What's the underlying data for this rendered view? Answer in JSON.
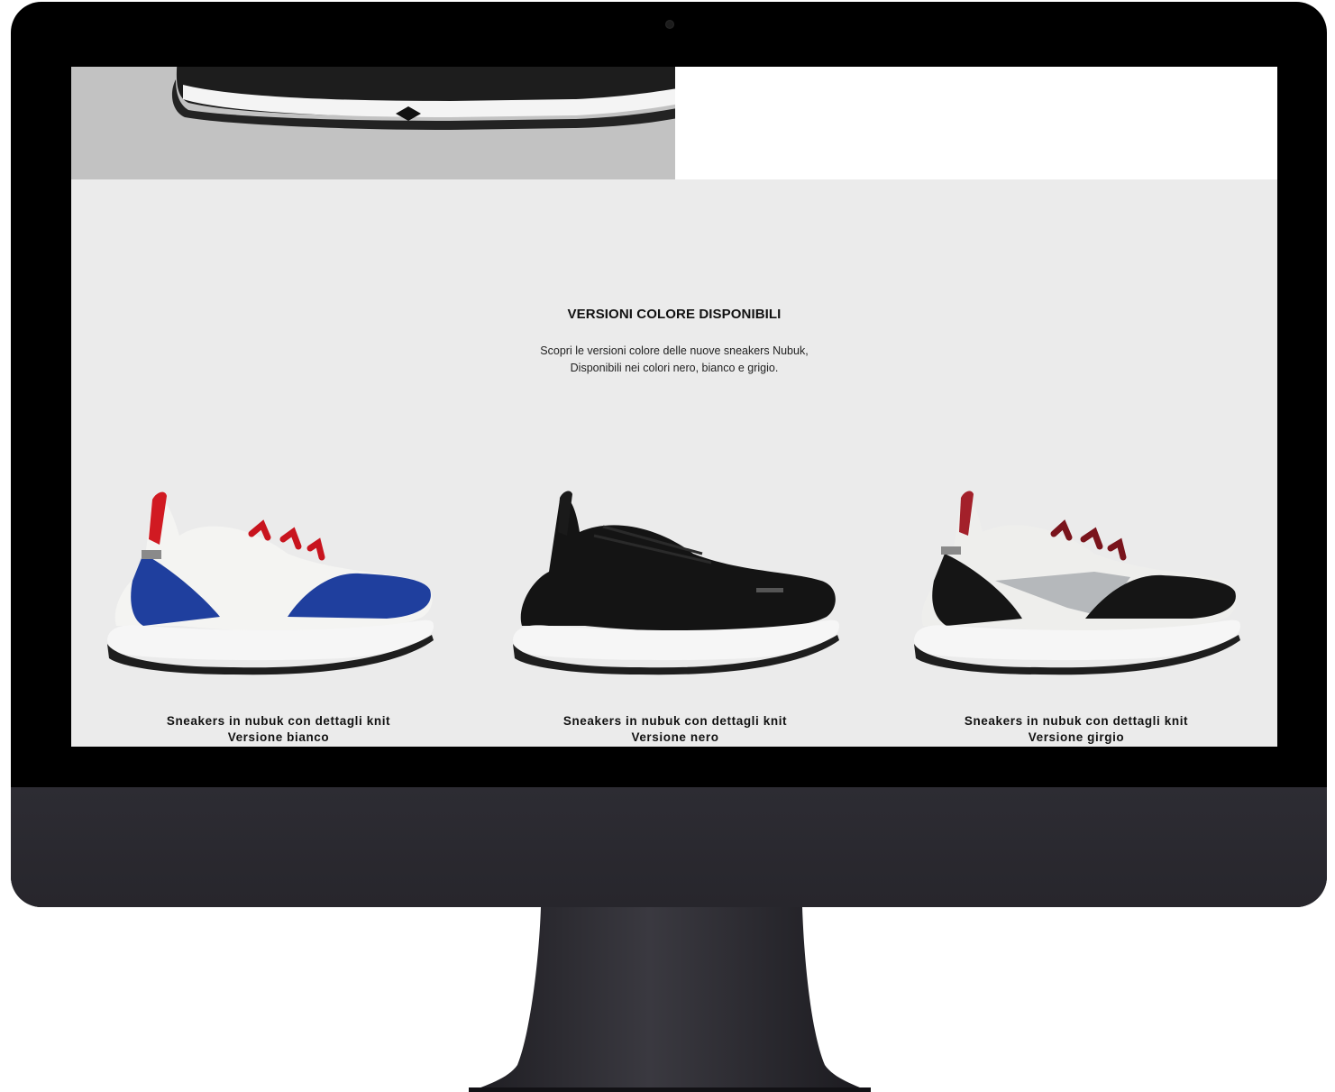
{
  "section": {
    "title": "VERSIONI COLORE DISPONIBILI",
    "description_line1": "Scopri le versioni colore delle nuove sneakers Nubuk,",
    "description_line2": "Disponibili nei colori nero, bianco e grigio."
  },
  "products": [
    {
      "name": "Sneakers in nubuk con dettagli knit",
      "variant": "Versione bianco",
      "colors": {
        "upper": "#f4f4f2",
        "suede": "#1f3f9e",
        "laces": "#c8141e",
        "tab": "#d11a22"
      }
    },
    {
      "name": "Sneakers in nubuk con dettagli knit",
      "variant": "Versione nero",
      "colors": {
        "upper": "#141414",
        "suede": "#0d0d0d",
        "laces": "#111111",
        "tab": "#1a1a1a"
      }
    },
    {
      "name": "Sneakers in nubuk con dettagli knit",
      "variant": "Versione girgio",
      "colors": {
        "upper": "#eeeeec",
        "suede": "#151515",
        "laces": "#7a141c",
        "tab": "#a3202a"
      }
    }
  ],
  "colors": {
    "page_background": "#ebebeb",
    "hero_gray": "#c2c2c2",
    "bezel": "#000000",
    "chin": "#2a292f"
  }
}
